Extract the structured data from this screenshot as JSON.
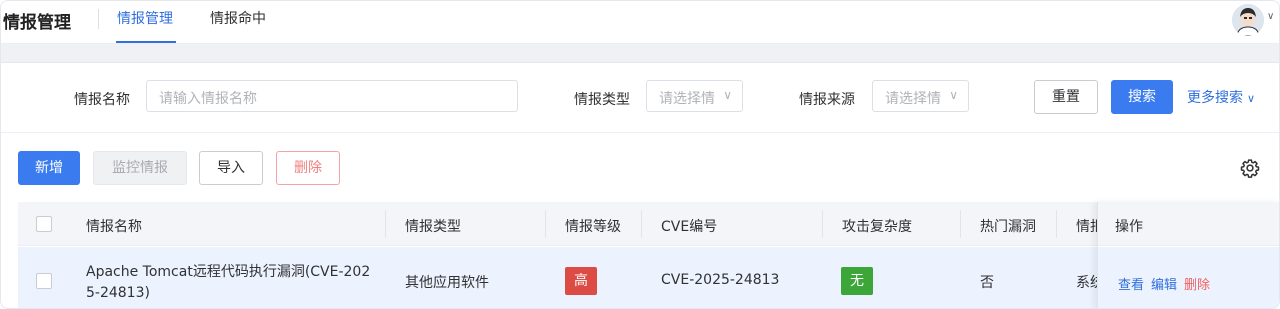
{
  "header": {
    "app_title": "情报管理",
    "tabs": [
      {
        "label": "情报管理"
      },
      {
        "label": "情报命中"
      }
    ]
  },
  "search": {
    "name_label": "情报名称",
    "name_placeholder": "请输入情报名称",
    "type_label": "情报类型",
    "type_placeholder": "请选择情",
    "source_label": "情报来源",
    "source_placeholder": "请选择情",
    "reset_label": "重置",
    "search_label": "搜索",
    "more_label": "更多搜索"
  },
  "toolbar": {
    "add_label": "新增",
    "monitor_label": "监控情报",
    "import_label": "导入",
    "delete_label": "删除",
    "settings_icon": "gear-icon"
  },
  "table": {
    "columns": [
      "情报名称",
      "情报类型",
      "情报等级",
      "CVE编号",
      "攻击复杂度",
      "热门漏洞",
      "情报来源",
      "操作"
    ],
    "rows": [
      {
        "name_line1": "Apache Tomcat远程代码执行漏洞(CVE-202",
        "name_line2": "5-24813)",
        "type": "其他应用软件",
        "level": "高",
        "cve": "CVE-2025-24813",
        "complexity": "无",
        "hot": "否",
        "source": "系统",
        "actions": {
          "view": "查看",
          "edit": "编辑",
          "delete": "删除"
        }
      }
    ]
  },
  "colors": {
    "primary": "#3a7cf0",
    "level_high": "#dd4b45",
    "complexity_none": "#3da638",
    "danger": "#f08080"
  }
}
